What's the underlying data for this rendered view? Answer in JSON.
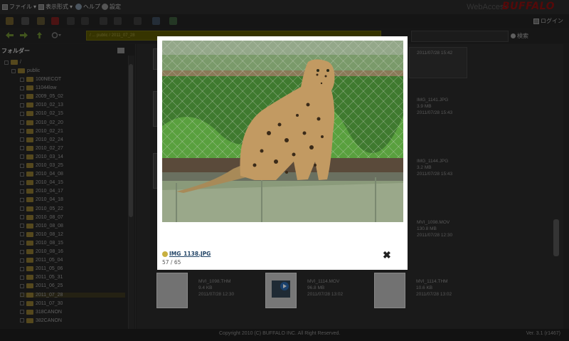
{
  "menubar": {
    "file": "ファイル",
    "view": "表示形式",
    "help": "ヘルプ",
    "settings": "設定",
    "product": "WebAccess",
    "brand": "BUFFALO"
  },
  "toolbar": {
    "login": "ログイン"
  },
  "address": {
    "path": "/ ... public / 2011_07_28",
    "search_label": "検索"
  },
  "sidebar": {
    "header": "フォルダー",
    "root": "/",
    "public": "public",
    "folders": [
      "100NECOT",
      "11044low",
      "2009_05_02",
      "2010_02_13",
      "2010_02_15",
      "2010_02_20",
      "2010_02_21",
      "2010_02_24",
      "2010_02_27",
      "2010_03_14",
      "2010_03_25",
      "2010_04_08",
      "2010_04_15",
      "2010_04_17",
      "2010_04_18",
      "2010_05_22",
      "2010_08_07",
      "2010_08_08",
      "2010_08_12",
      "2010_08_15",
      "2010_08_16",
      "2011_05_04",
      "2011_05_06",
      "2011_05_31",
      "2011_06_25",
      "2011_07_28",
      "2011_07_30",
      "318CANON",
      "382CANON"
    ],
    "selected_index": 25
  },
  "files": {
    "top_right": {
      "date": "2011/07/28 15:42"
    },
    "img1141": {
      "name": "IMG_1141.JPG",
      "size": "3.9 MB",
      "date": "2011/07/28 15:43"
    },
    "img1144": {
      "name": "IMG_1144.JPG",
      "size": "3.2 MB",
      "date": "2011/07/28 15:43"
    },
    "mvi1098mov": {
      "name": "MVI_1098.MOV",
      "size": "130.8 MB",
      "date": "2011/07/28 12:30"
    },
    "mvi1098thm": {
      "name": "MVI_1098.THM",
      "size": "9.4 KB",
      "date": "2011/07/28 12:30"
    },
    "mvi1114mov": {
      "name": "MVI_1114.MOV",
      "size": "96.8 MB",
      "date": "2011/07/28 13:02"
    },
    "mvi1114thm": {
      "name": "MVI_1114.THM",
      "size": "10.6 KB",
      "date": "2011/07/28 13:02"
    }
  },
  "footer": {
    "copyright": "Copyright 2010 (C) BUFFALO INC. All Right Reserved.",
    "version": "Ver. 3.1 (r1467)"
  },
  "lightbox": {
    "filename": "IMG_1138.JPG",
    "counter": "57 / 65",
    "close": "✖"
  },
  "colors": {
    "brand": "#8a1010",
    "path_bar": "#585400",
    "lightbox_bg": "#ffffff"
  }
}
